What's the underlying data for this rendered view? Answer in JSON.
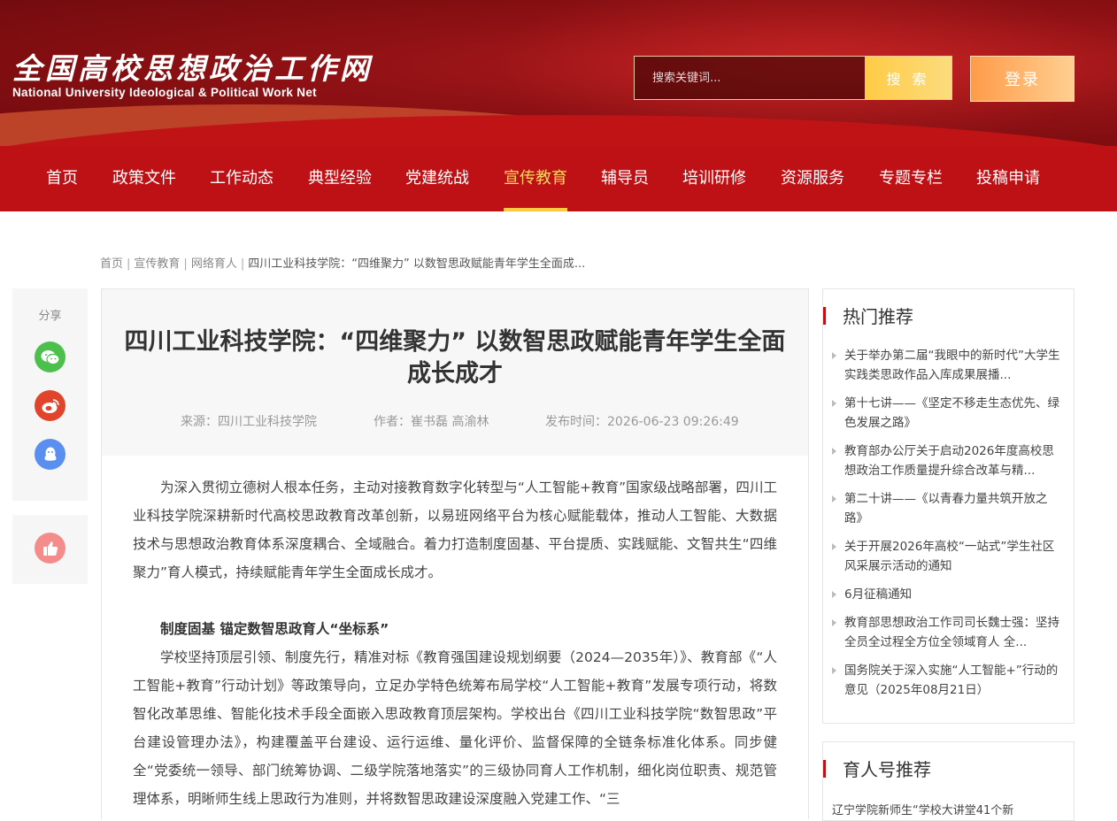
{
  "site": {
    "name_cn": "全国高校思想政治工作网",
    "name_en": "National University Ideological & Political Work Net"
  },
  "search": {
    "placeholder": "搜索关键词...",
    "button": "搜 索"
  },
  "login": "登录",
  "nav": [
    {
      "label": "首页"
    },
    {
      "label": "政策文件"
    },
    {
      "label": "工作动态"
    },
    {
      "label": "典型经验"
    },
    {
      "label": "党建统战"
    },
    {
      "label": "宣传教育",
      "active": true
    },
    {
      "label": "辅导员"
    },
    {
      "label": "培训研修"
    },
    {
      "label": "资源服务"
    },
    {
      "label": "专题专栏"
    },
    {
      "label": "投稿申请"
    }
  ],
  "breadcrumb": {
    "home": "首页",
    "sep": "|",
    "level1": "宣传教育",
    "level2": "网络育人",
    "current": "四川工业科技学院：“四维聚力” 以数智思政赋能青年学生全面成..."
  },
  "share": {
    "title": "分享",
    "icons": [
      "wechat-icon",
      "weibo-icon",
      "qq-icon"
    ]
  },
  "like_icon": "thumbs-up-icon",
  "article": {
    "title": "四川工业科技学院：“四维聚力” 以数智思政赋能青年学生全面成长成才",
    "source": "来源：四川工业科技学院",
    "author": "作者：崔书磊 高渝林",
    "time": "发布时间：2026-06-23 09:26:49",
    "para1": "为深入贯彻立德树人根本任务，主动对接教育数字化转型与“人工智能+教育”国家级战略部署，四川工业科技学院深耕新时代高校思政教育改革创新，以易班网络平台为核心赋能载体，推动人工智能、大数据技术与思想政治教育体系深度耦合、全域融合。着力打造制度固基、平台提质、实践赋能、文智共生“四维聚力”育人模式，持续赋能青年学生全面成长成才。",
    "subhead1": "制度固基 锚定数智思政育人“坐标系”",
    "para2": "学校坚持顶层引领、制度先行，精准对标《教育强国建设规划纲要（2024—2035年）》、教育部《“人工智能+教育”行动计划》等政策导向，立足办学特色统筹布局学校“人工智能+教育”发展专项行动，将数智化改革思维、智能化技术手段全面嵌入思政教育顶层架构。学校出台《四川工业科技学院“数智思政”平台建设管理办法》，构建覆盖平台建设、运行运维、量化评价、监督保障的全链条标准化体系。同步健全“党委统一领导、部门统筹协调、二级学院落地落实”的三级协同育人工作机制，细化岗位职责、规范管理体系，明晰师生线上思政行为准则，并将数智思政建设深度融入党建工作、“三"
  },
  "hot": {
    "title": "热门推荐",
    "items": [
      "关于举办第二届“我眼中的新时代”大学生实践类思政作品入库成果展播...",
      "第十七讲——《坚定不移走生态优先、绿色发展之路》",
      "教育部办公厅关于启动2026年度高校思想政治工作质量提升综合改革与精...",
      "第二十讲——《以青春力量共筑开放之路》",
      "关于开展2026年高校“一站式”学生社区风采展示活动的通知",
      "6月征稿通知",
      "教育部思想政治工作司司长魏士强：坚持全员全过程全方位全领域育人 全...",
      "国务院关于深入实施“人工智能+”行动的意见（2025年08月21日）"
    ]
  },
  "yuren": {
    "title": "育人号推荐",
    "snippet": "辽宁学院新师生“学校大讲堂41个新"
  }
}
